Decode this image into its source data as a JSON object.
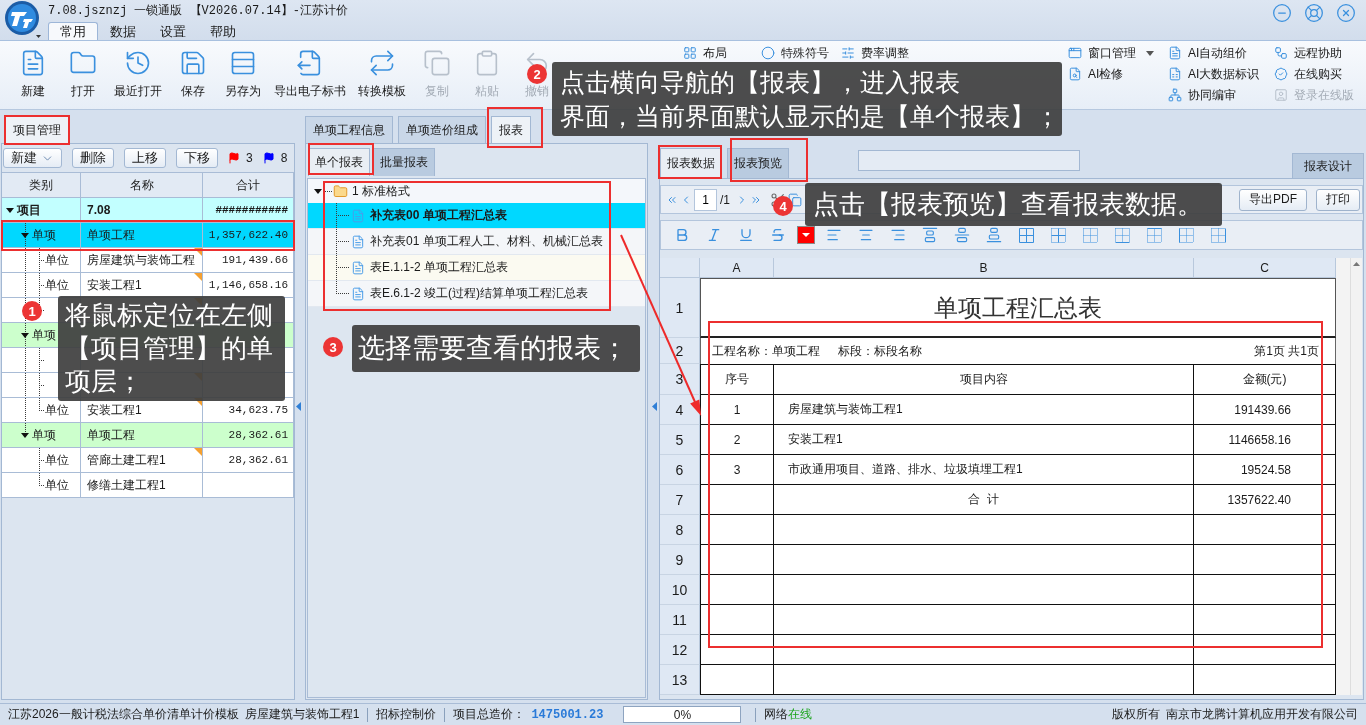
{
  "window": {
    "title": "7.08.jsznzj 一锁通版 【V2026.07.14】-江苏计价"
  },
  "menu_tabs": [
    {
      "label": "常用",
      "selected": true
    },
    {
      "label": "数据",
      "selected": false
    },
    {
      "label": "设置",
      "selected": false
    },
    {
      "label": "帮助",
      "selected": false
    }
  ],
  "toolbar": {
    "buttons": [
      {
        "label": "新建",
        "disabled": false
      },
      {
        "label": "打开",
        "disabled": false
      },
      {
        "label": "最近打开",
        "disabled": false
      },
      {
        "label": "保存",
        "disabled": false
      },
      {
        "label": "另存为",
        "disabled": false
      },
      {
        "label": "导出电子标书",
        "disabled": false
      },
      {
        "label": "转换模板",
        "disabled": false
      },
      {
        "label": "复制",
        "disabled": true
      },
      {
        "label": "粘贴",
        "disabled": true
      },
      {
        "label": "撤销",
        "disabled": true
      }
    ],
    "tool_columns": [
      [
        {
          "label": "布局",
          "disabled": false,
          "dropdown": false
        }
      ],
      [
        {
          "label": "特殊符号",
          "disabled": false,
          "dropdown": false
        }
      ],
      [
        {
          "label": "费率调整",
          "disabled": false,
          "dropdown": false
        }
      ],
      [
        {
          "label": "窗口管理",
          "disabled": false,
          "dropdown": true
        },
        {
          "label": "AI检修",
          "disabled": false,
          "dropdown": false
        }
      ],
      [
        {
          "label": "AI自动组价",
          "disabled": false,
          "dropdown": false
        },
        {
          "label": "AI大数据标识",
          "disabled": false,
          "dropdown": false
        },
        {
          "label": "协同编审",
          "disabled": false,
          "dropdown": false
        }
      ],
      [
        {
          "label": "远程协助",
          "disabled": false,
          "dropdown": false
        },
        {
          "label": "在线购买",
          "disabled": false,
          "dropdown": false
        },
        {
          "label": "登录在线版",
          "disabled": true,
          "dropdown": false
        }
      ]
    ]
  },
  "project_panel": {
    "tab": {
      "label": "项目管理",
      "selected": true,
      "highlighted": true
    },
    "buttons": [
      {
        "label": "新建",
        "dropdown": true
      },
      {
        "label": "删除",
        "dropdown": false
      },
      {
        "label": "上移",
        "dropdown": false
      },
      {
        "label": "下移",
        "dropdown": false
      }
    ],
    "flags": [
      {
        "color": "#ff0000",
        "count": "3"
      },
      {
        "color": "#0000ff",
        "count": "8"
      }
    ],
    "columns": [
      "类别",
      "名称",
      "合计"
    ],
    "tree": {
      "category": "项目",
      "name": "7.08",
      "total": "###########",
      "selected": false,
      "highlighted": false,
      "expanded": true,
      "children": [
        {
          "category": "单项",
          "name": "单项工程",
          "total": "1,357,622.40",
          "selected": true,
          "highlighted": true,
          "expanded": true,
          "children": [
            {
              "category": "单位",
              "name": "房屋建筑与装饰工程",
              "total": "191,439.66",
              "selected": false,
              "highlighted": false,
              "marked": true
            },
            {
              "category": "单位",
              "name": "安装工程1",
              "total": "1,146,658.16",
              "selected": false,
              "highlighted": false,
              "marked": true
            },
            {
              "selected": false,
              "highlighted": false,
              "marked": true
            }
          ]
        },
        {
          "category": "单项",
          "selected": false,
          "highlighted": false,
          "expanded": true,
          "children": [
            {
              "selected": false,
              "highlighted": false,
              "marked": false
            },
            {
              "selected": false,
              "highlighted": false,
              "marked": true
            },
            {
              "category": "单位",
              "name": "安装工程1",
              "total": "34,623.75",
              "selected": false,
              "highlighted": false,
              "marked": true
            }
          ]
        },
        {
          "category": "单项",
          "name": "单项工程",
          "total": "28,362.61",
          "selected": false,
          "highlighted": false,
          "expanded": true,
          "children": [
            {
              "category": "单位",
              "name": "管廊土建工程1",
              "total": "28,362.61",
              "selected": false,
              "highlighted": false,
              "marked": true
            },
            {
              "category": "单位",
              "name": "修缮土建工程1",
              "selected": false,
              "highlighted": false,
              "marked": false
            }
          ]
        }
      ]
    }
  },
  "detail_tabs": [
    {
      "label": "单项工程信息",
      "selected": false,
      "highlighted": false
    },
    {
      "label": "单项造价组成",
      "selected": false,
      "highlighted": false
    },
    {
      "label": "报表",
      "selected": true,
      "highlighted": true
    }
  ],
  "report_tabs": [
    {
      "label": "单个报表",
      "selected": true,
      "highlighted": true
    },
    {
      "label": "批量报表",
      "selected": false,
      "highlighted": false
    }
  ],
  "report_tree": {
    "highlighted": true,
    "folders": [
      {
        "label": "1 标准格式",
        "expanded": true,
        "children": [
          {
            "label": "补充表00 单项工程汇总表",
            "selected": true
          },
          {
            "label": "补充表01 单项工程人工、材料、机械汇总表",
            "selected": false
          },
          {
            "label": "表E.1.1-2 单项工程汇总表",
            "selected": false
          },
          {
            "label": "表E.6.1-2 竣工(过程)结算单项工程汇总表",
            "selected": false
          }
        ]
      }
    ]
  },
  "view_tabs": [
    {
      "label": "报表数据",
      "selected": true,
      "highlighted": true
    },
    {
      "label": "报表预览",
      "selected": false,
      "highlighted": true
    }
  ],
  "design_button": "报表设计",
  "pager": {
    "page": "1",
    "total": "/1"
  },
  "export_buttons": [
    "导出PDF",
    "打印"
  ],
  "sheet": {
    "highlighted": true,
    "columns": [
      "A",
      "B",
      "C"
    ],
    "row_numbers": [
      "1",
      "2",
      "3",
      "4",
      "5",
      "6",
      "7",
      "8",
      "9",
      "10",
      "11",
      "12",
      "13"
    ],
    "title": "单项工程汇总表",
    "info_left": "工程名称：单项工程",
    "info_middle": "标段：标段名称",
    "info_right": "第1页 共1页",
    "headers": [
      "序号",
      "项目内容",
      "金额(元)"
    ],
    "rows": [
      [
        "1",
        "房屋建筑与装饰工程1",
        "191439.66"
      ],
      [
        "2",
        "安装工程1",
        "1146658.16"
      ],
      [
        "3",
        "市政通用项目、道路、排水、垃圾填埋工程1",
        "19524.58"
      ]
    ],
    "total_label": "合  计",
    "total_value": "1357622.40"
  },
  "status_bar": {
    "template": "江苏2026一般计税法综合单价清单计价模板",
    "project": "房屋建筑与装饰工程1",
    "price_type": "招标控制价",
    "total_label": "项目总造价：",
    "total_value": "1475001.23",
    "progress": {
      "reading": "0%"
    },
    "network_label": "网络",
    "network_state": "在线",
    "online": true,
    "copyright": "版权所有",
    "company": "南京市龙腾计算机应用开发有限公司"
  },
  "annotations": {
    "callouts": [
      {
        "number": "1",
        "lines": [
          "将鼠标定位在左侧【项目管理】的单项层；"
        ]
      },
      {
        "number": "2",
        "lines": [
          "点击横向导航的【报表】，进入报表",
          "界面，当前界面默认显示的是【单个报表】；"
        ]
      },
      {
        "number": "3",
        "lines": [
          "选择需要查看的报表；"
        ]
      },
      {
        "number": "4",
        "lines": [
          "点击【报表预览】查看报表数据。"
        ]
      }
    ],
    "arrow": true
  }
}
